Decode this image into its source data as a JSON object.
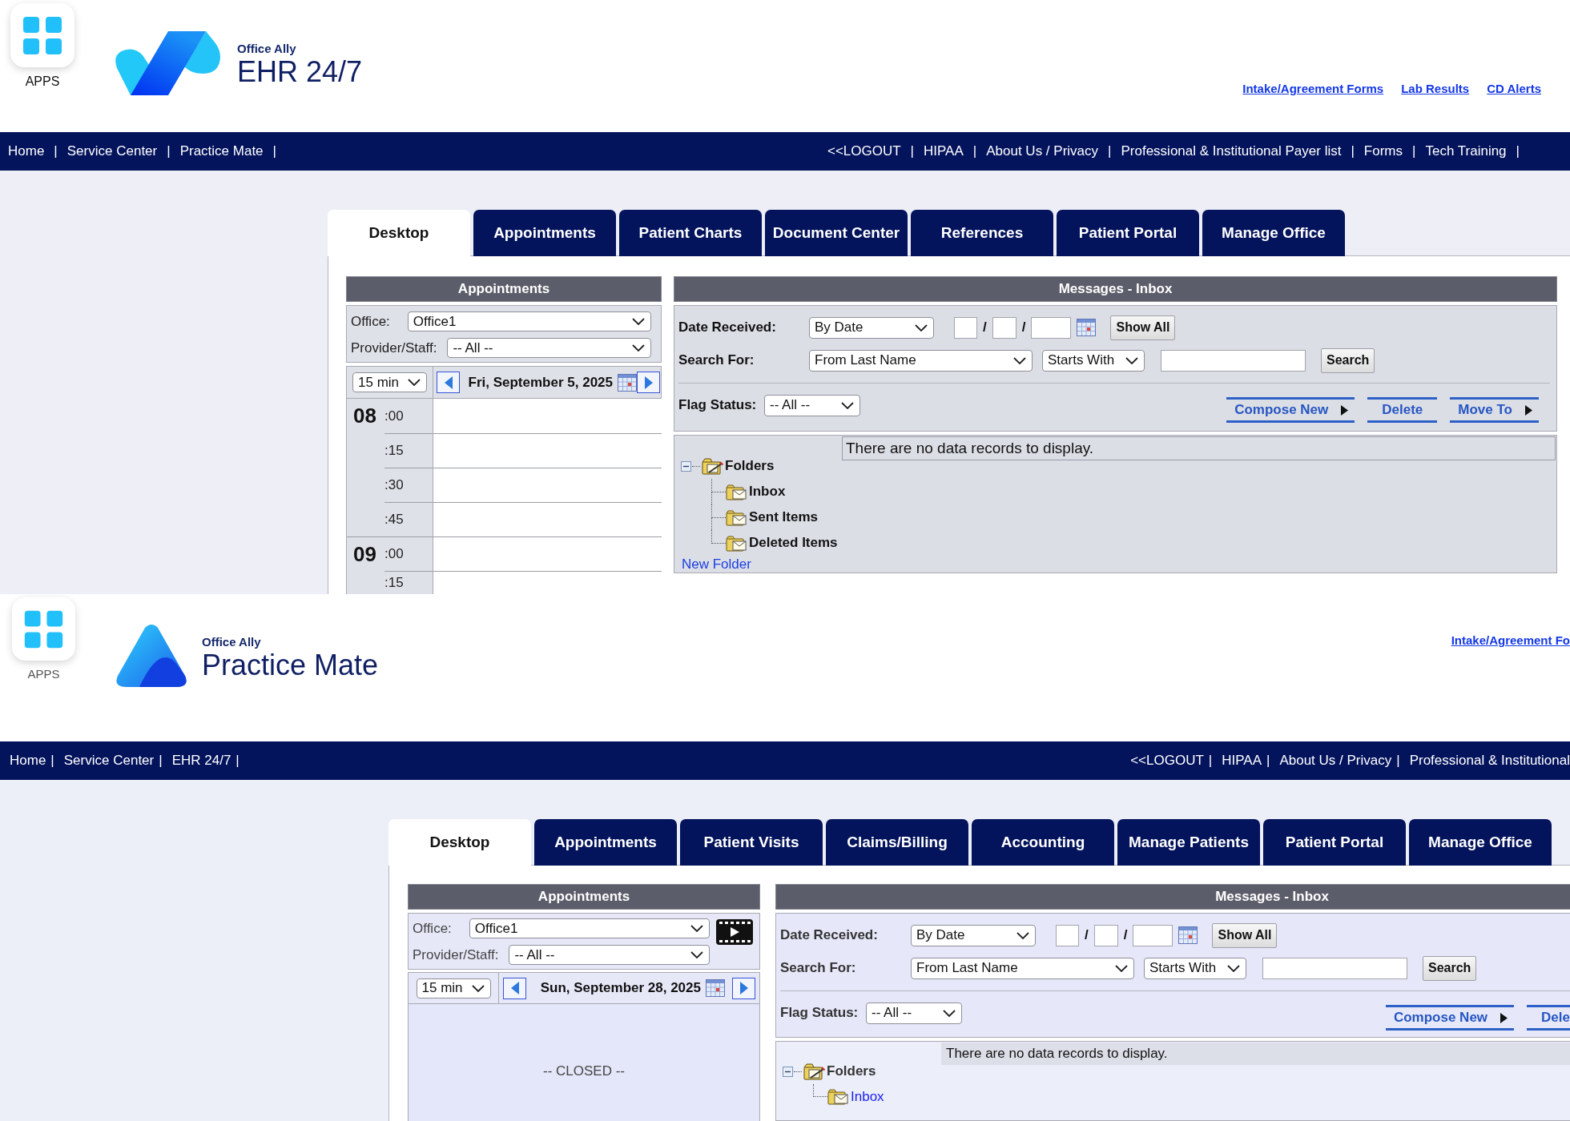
{
  "screens": [
    {
      "apps_label": "APPS",
      "logo": {
        "kind": "ribbon",
        "brand": "Office Ally",
        "product": "EHR 24/7"
      },
      "header_links": [
        "Intake/Agreement Forms",
        "Lab Results",
        "CD Alerts"
      ],
      "nav": {
        "left": [
          {
            "label": "Home",
            "separator": "|"
          },
          {
            "label": "Service Center",
            "separator": "|"
          },
          {
            "label": "Practice Mate",
            "separator": "|"
          }
        ],
        "right": [
          {
            "label": "<<LOGOUT",
            "separator": "|"
          },
          {
            "label": "HIPAA",
            "separator": "|"
          },
          {
            "label": "About Us / Privacy",
            "separator": "|"
          },
          {
            "label": "Professional & Institutional Payer list",
            "separator": "|"
          },
          {
            "label": "Forms",
            "separator": "|"
          },
          {
            "label": "Tech Training",
            "separator": "|"
          }
        ]
      },
      "tabs": [
        {
          "label": "Desktop",
          "selected": true
        },
        {
          "label": "Appointments",
          "selected": false
        },
        {
          "label": "Patient Charts",
          "selected": false
        },
        {
          "label": "Document Center",
          "selected": false
        },
        {
          "label": "References",
          "selected": false
        },
        {
          "label": "Patient Portal",
          "selected": false
        },
        {
          "label": "Manage Office",
          "selected": false
        }
      ],
      "appointments": {
        "title": "Appointments",
        "office_label": "Office:",
        "office": "Office1",
        "provider_label": "Provider/Staff:",
        "provider": "-- All --",
        "interval": "15 min",
        "date": "Fri, September 5, 2025",
        "slots": [
          {
            "hour": "08",
            "minute": ":00"
          },
          {
            "minute": ":15"
          },
          {
            "minute": ":30"
          },
          {
            "minute": ":45"
          },
          {
            "hour": "09",
            "minute": ":00"
          },
          {
            "minute": ":15"
          }
        ]
      },
      "messages": {
        "title": "Messages - Inbox",
        "date_label": "Date Received:",
        "date_mode": "By Date",
        "date_separators": [
          "/",
          "/"
        ],
        "show_all": "Show All",
        "search_label": "Search For:",
        "search_by": "From Last Name",
        "match": "Starts With",
        "search_button": "Search",
        "flag_label": "Flag Status:",
        "flag": "-- All --",
        "actions": [
          {
            "label": "Compose New",
            "menu": true
          },
          {
            "label": "Delete",
            "menu": false
          },
          {
            "label": "Move To",
            "menu": true
          }
        ],
        "empty_text": "There are no data records to display.",
        "folders": {
          "label": "Folders",
          "expanded": true,
          "children": [
            {
              "label": "Inbox",
              "kind": "bold"
            },
            {
              "label": "Sent Items",
              "kind": "bold"
            },
            {
              "label": "Deleted Items",
              "kind": "bold"
            }
          ]
        },
        "new_folder": "New Folder"
      }
    },
    {
      "apps_label": "APPS",
      "logo": {
        "kind": "peak",
        "brand": "Office Ally",
        "product": "Practice Mate"
      },
      "header_links": [
        "Intake/Agreement Fo"
      ],
      "nav": {
        "left": [
          {
            "label": "Home",
            "separator": "|"
          },
          {
            "label": "Service Center",
            "separator": "|"
          },
          {
            "label": "EHR 24/7",
            "separator": "|"
          }
        ],
        "right": [
          {
            "label": "<<LOGOUT",
            "separator": "|"
          },
          {
            "label": "HIPAA",
            "separator": "|"
          },
          {
            "label": "About Us / Privacy",
            "separator": "|"
          },
          {
            "label": "Professional & Institutional"
          }
        ]
      },
      "tabs": [
        {
          "label": "Desktop",
          "selected": true
        },
        {
          "label": "Appointments",
          "selected": false
        },
        {
          "label": "Patient Visits",
          "selected": false
        },
        {
          "label": "Claims/Billing",
          "selected": false
        },
        {
          "label": "Accounting",
          "selected": false
        },
        {
          "label": "Manage Patients",
          "selected": false
        },
        {
          "label": "Patient Portal",
          "selected": false
        },
        {
          "label": "Manage Office",
          "selected": false
        }
      ],
      "appointments": {
        "title": "Appointments",
        "office_label": "Office:",
        "office": "Office1",
        "provider_label": "Provider/Staff:",
        "provider": "-- All --",
        "video_button": true,
        "interval": "15 min",
        "date": "Sun, September 28, 2025",
        "closed_text": "-- CLOSED --"
      },
      "messages": {
        "title": "Messages - Inbox",
        "date_label": "Date Received:",
        "date_mode": "By Date",
        "date_separators": [
          "/",
          "/"
        ],
        "show_all": "Show All",
        "search_label": "Search For:",
        "search_by": "From Last Name",
        "match": "Starts With",
        "search_button": "Search",
        "flag_label": "Flag Status:",
        "flag": "-- All --",
        "actions": [
          {
            "label": "Compose New",
            "menu": true
          },
          {
            "label": "Dele",
            "menu": false
          }
        ],
        "empty_text": "There are no data records to display.",
        "folders": {
          "label": "Folders",
          "expanded": true,
          "children": [
            {
              "label": "Inbox",
              "kind": "link"
            }
          ]
        }
      }
    }
  ]
}
